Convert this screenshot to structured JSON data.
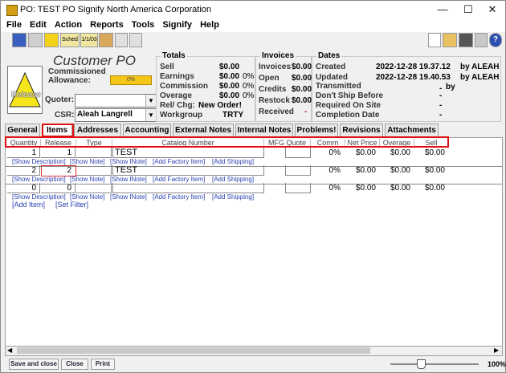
{
  "window": {
    "title": "PO: TEST PO   Signify North America Corporation",
    "controls": [
      "—",
      "☐",
      "✕"
    ]
  },
  "menu": [
    "File",
    "Edit",
    "Action",
    "Reports",
    "Tools",
    "Signify",
    "Help"
  ],
  "toolbar": {
    "sched_label": "Sched",
    "date_label": "1/1/03"
  },
  "header": {
    "title": "Customer PO",
    "release_label": "Release",
    "commissioned_label": "Commissioned",
    "allowance_label": "Allowance:",
    "allowance_pct": "0%",
    "quoter_label": "Quoter:",
    "quoter_value": "",
    "csr_label": "CSR:",
    "csr_value": "Aleah Langrell",
    "totals": {
      "title": "Totals",
      "rows": [
        {
          "label": "Sell",
          "value": "$0.00",
          "pct": ""
        },
        {
          "label": "Earnings",
          "value": "$0.00",
          "pct": "0%"
        },
        {
          "label": "Commission",
          "value": "$0.00",
          "pct": "0%"
        },
        {
          "label": "Overage",
          "value": "$0.00",
          "pct": "0%"
        }
      ],
      "relchg_label": "Rel/ Chg:",
      "relchg_value": "New Order!",
      "workgroup_label": "Workgroup",
      "workgroup_value": "TRTY"
    },
    "invoices": {
      "title": "Invoices",
      "rows": [
        {
          "label": "Invoices",
          "value": "$0.00"
        },
        {
          "label": "Open",
          "value": "$0.00"
        },
        {
          "label": "Credits",
          "value": "$0.00"
        },
        {
          "label": "Restock",
          "value": "$0.00"
        },
        {
          "label": "Received",
          "value": "-"
        }
      ]
    },
    "dates": {
      "title": "Dates",
      "rows": [
        {
          "label": "Created",
          "value": "2022-12-28 19.37.12",
          "by": "by ALEAH"
        },
        {
          "label": "Updated",
          "value": "2022-12-28 19.40.53",
          "by": "by ALEAH"
        },
        {
          "label": "Transmitted",
          "value": "-",
          "by": "by"
        },
        {
          "label": "Don't Ship Before",
          "value": "-",
          "by": ""
        },
        {
          "label": "Required On Site",
          "value": "-",
          "by": ""
        },
        {
          "label": "Completion Date",
          "value": "-",
          "by": ""
        }
      ]
    }
  },
  "tabs": [
    "General",
    "Items",
    "Addresses",
    "Accounting",
    "External Notes",
    "Internal Notes",
    "Problems!",
    "Revisions",
    "Attachments"
  ],
  "active_tab": "Items",
  "columns": [
    "Quantity",
    "Release",
    "Type",
    "Catalog Number",
    "MFG Quote",
    "Comm",
    "Net Price",
    "Overage",
    "Sell"
  ],
  "rows": [
    {
      "quantity": "1",
      "release": "1",
      "type": "",
      "catalog": "TEST",
      "mfg_quote": "",
      "comm": "0%",
      "net_price": "$0.00",
      "overage": "$0.00",
      "sell": "$0.00"
    },
    {
      "quantity": "2",
      "release": "2",
      "type": "",
      "catalog": "TEST",
      "mfg_quote": "",
      "comm": "0%",
      "net_price": "$0.00",
      "overage": "$0.00",
      "sell": "$0.00"
    },
    {
      "quantity": "0",
      "release": "0",
      "type": "",
      "catalog": "",
      "mfg_quote": "",
      "comm": "0%",
      "net_price": "$0.00",
      "overage": "$0.00",
      "sell": "$0.00"
    }
  ],
  "row_links": [
    "[Show Description]",
    "[Show Note]",
    "[Show INote]",
    "[Add Factory Item]",
    "[Add Shipping]"
  ],
  "list_links": [
    "[Add Item]",
    "[Set Filter]"
  ],
  "footer": {
    "buttons": [
      "Save and close",
      "Close",
      "Print"
    ],
    "zoom": "100%"
  }
}
